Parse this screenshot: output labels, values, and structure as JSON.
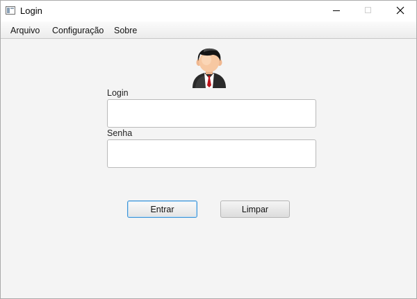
{
  "window": {
    "title": "Login",
    "icon": "java-app-icon",
    "controls": [
      "minimize-icon",
      "maximize-icon",
      "close-icon"
    ]
  },
  "menu": {
    "items": [
      {
        "label": "Arquivo"
      },
      {
        "label": "Configuração"
      },
      {
        "label": "Sobre"
      }
    ]
  },
  "form": {
    "avatar_icon": "user-avatar-icon",
    "login_label": "Login",
    "login_value": "",
    "password_label": "Senha",
    "password_value": "",
    "enter_button": "Entrar",
    "clear_button": "Limpar"
  },
  "colors": {
    "focus_border": "#3d93d6",
    "background": "#f4f4f4"
  }
}
